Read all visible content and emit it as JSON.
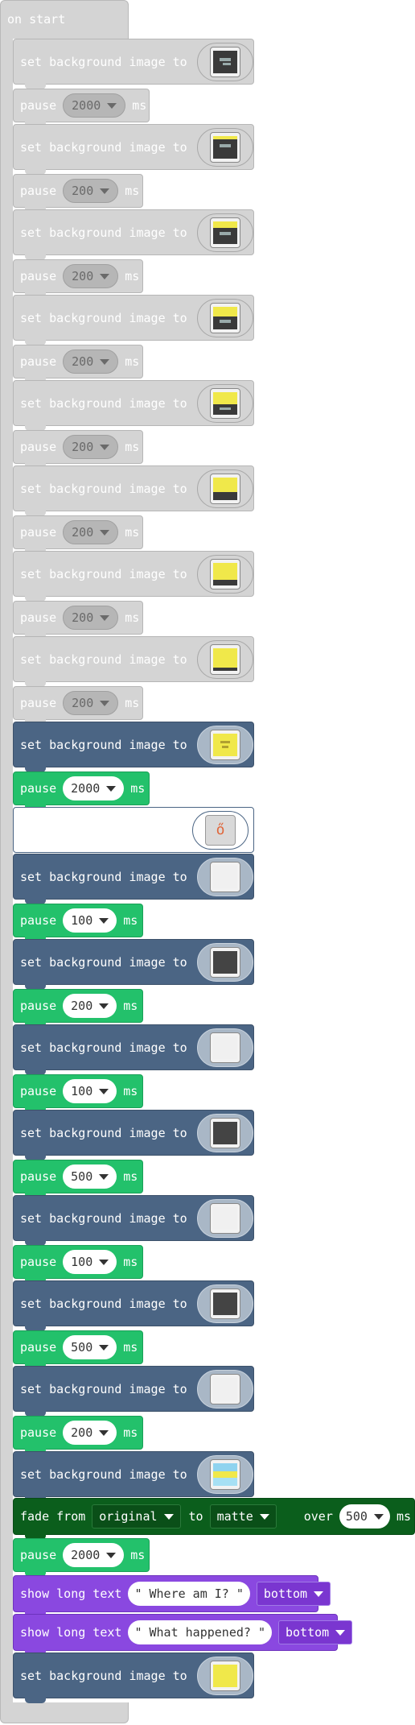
{
  "on_start": "on start",
  "labels": {
    "set_background": "set background image to",
    "pause": "pause",
    "ms": "ms",
    "fade_from": "fade from",
    "to": "to",
    "over": "over",
    "show_long_text": "show long text"
  },
  "disabled_pauses": [
    "2000",
    "200",
    "200",
    "200",
    "200",
    "200",
    "200",
    "200"
  ],
  "enabled_pauses": [
    "2000",
    "100",
    "200",
    "100",
    "500",
    "100",
    "500",
    "200",
    "2000"
  ],
  "fade": {
    "from": "original",
    "to": "matte",
    "duration": "500"
  },
  "long_texts": [
    {
      "text": "\" Where am I? \"",
      "position": "bottom"
    },
    {
      "text": "\" What happened? \"",
      "position": "bottom"
    }
  ],
  "placeholder_icon": "image-icon"
}
